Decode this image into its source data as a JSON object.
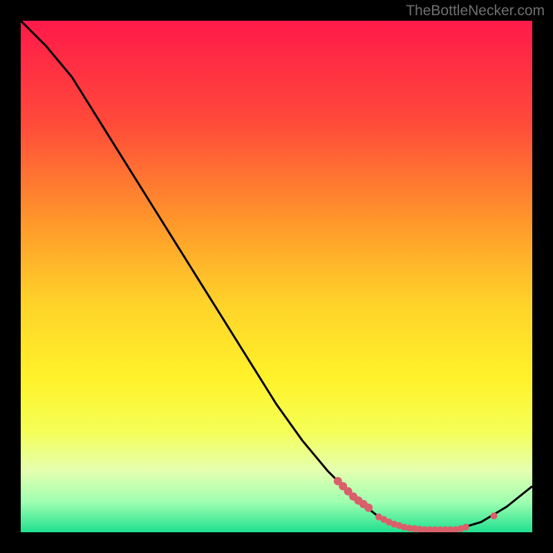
{
  "watermark": "TheBottleNecker.com",
  "chart_data": {
    "type": "line",
    "title": "",
    "xlabel": "",
    "ylabel": "",
    "xlim": [
      0,
      100
    ],
    "ylim": [
      0,
      100
    ],
    "gradient_stops": [
      {
        "offset": 0,
        "color": "#ff1a4a"
      },
      {
        "offset": 20,
        "color": "#ff4a3a"
      },
      {
        "offset": 40,
        "color": "#ff9a2a"
      },
      {
        "offset": 55,
        "color": "#ffd22a"
      },
      {
        "offset": 70,
        "color": "#fff22a"
      },
      {
        "offset": 80,
        "color": "#f5ff55"
      },
      {
        "offset": 88,
        "color": "#e5ffb0"
      },
      {
        "offset": 94,
        "color": "#a0ffb0"
      },
      {
        "offset": 100,
        "color": "#20e090"
      }
    ],
    "curve": [
      {
        "x": 0,
        "y": 100
      },
      {
        "x": 5,
        "y": 95
      },
      {
        "x": 10,
        "y": 89
      },
      {
        "x": 15,
        "y": 81
      },
      {
        "x": 20,
        "y": 73
      },
      {
        "x": 25,
        "y": 65
      },
      {
        "x": 30,
        "y": 57
      },
      {
        "x": 35,
        "y": 49
      },
      {
        "x": 40,
        "y": 41
      },
      {
        "x": 45,
        "y": 33
      },
      {
        "x": 50,
        "y": 25
      },
      {
        "x": 55,
        "y": 18
      },
      {
        "x": 60,
        "y": 12
      },
      {
        "x": 65,
        "y": 7
      },
      {
        "x": 70,
        "y": 3
      },
      {
        "x": 75,
        "y": 1
      },
      {
        "x": 80,
        "y": 0.5
      },
      {
        "x": 85,
        "y": 0.5
      },
      {
        "x": 90,
        "y": 2
      },
      {
        "x": 95,
        "y": 5
      },
      {
        "x": 100,
        "y": 9
      }
    ],
    "markers_segment1": [
      {
        "x": 62,
        "y": 10
      },
      {
        "x": 63,
        "y": 9
      },
      {
        "x": 64,
        "y": 8
      },
      {
        "x": 65,
        "y": 7
      },
      {
        "x": 66,
        "y": 6.2
      },
      {
        "x": 67,
        "y": 5.5
      },
      {
        "x": 68,
        "y": 4.8
      }
    ],
    "markers_bottom": [
      {
        "x": 70,
        "y": 3.0
      },
      {
        "x": 71,
        "y": 2.5
      },
      {
        "x": 72,
        "y": 2.0
      },
      {
        "x": 73,
        "y": 1.6
      },
      {
        "x": 74,
        "y": 1.3
      },
      {
        "x": 75,
        "y": 1.0
      },
      {
        "x": 76,
        "y": 0.8
      },
      {
        "x": 77,
        "y": 0.7
      },
      {
        "x": 78,
        "y": 0.6
      },
      {
        "x": 79,
        "y": 0.5
      },
      {
        "x": 80,
        "y": 0.5
      },
      {
        "x": 81,
        "y": 0.5
      },
      {
        "x": 82,
        "y": 0.5
      },
      {
        "x": 83,
        "y": 0.5
      },
      {
        "x": 84,
        "y": 0.5
      },
      {
        "x": 85,
        "y": 0.5
      },
      {
        "x": 86,
        "y": 0.7
      },
      {
        "x": 87,
        "y": 1.0
      }
    ],
    "markers_right": [
      {
        "x": 92.5,
        "y": 3.2
      }
    ]
  }
}
